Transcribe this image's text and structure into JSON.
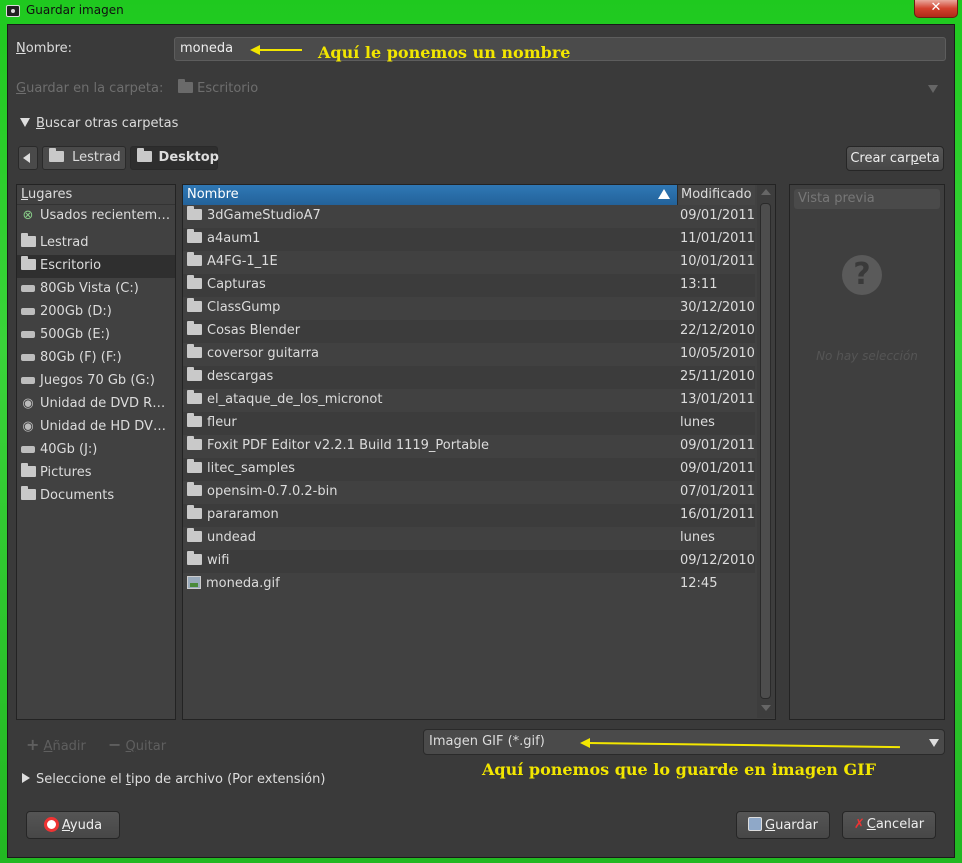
{
  "window": {
    "title": "Guardar imagen",
    "close_glyph": "✕"
  },
  "form": {
    "name_label_mnemonic": "N",
    "name_label_rest": "ombre:",
    "name_value": "moneda",
    "save_in_mnemonic": "G",
    "save_in_rest": "uardar en la carpeta:",
    "save_in_value": "Escritorio",
    "browse_mnemonic": "B",
    "browse_rest": "uscar otras carpetas"
  },
  "annotations": {
    "name_note": "Aquí le ponemos un nombre",
    "type_note": "Aquí ponemos que lo guarde en imagen GIF"
  },
  "path_bar": {
    "segments": [
      "Lestrad",
      "Desktop"
    ],
    "create_folder_prefix": "Crear car",
    "create_folder_mnemonic": "p",
    "create_folder_suffix": "eta"
  },
  "places": {
    "header_mnemonic": "L",
    "header_rest": "ugares",
    "items": [
      {
        "label": "Usados recientem…",
        "icon": "recent-icon"
      },
      {
        "label": "Lestrad",
        "icon": "folder-icon"
      },
      {
        "label": "Escritorio",
        "icon": "folder-icon",
        "selected": true
      },
      {
        "label": "80Gb Vista (C:)",
        "icon": "drive-icon"
      },
      {
        "label": "200Gb (D:)",
        "icon": "drive-icon"
      },
      {
        "label": "500Gb (E:)",
        "icon": "drive-icon"
      },
      {
        "label": "80Gb (F) (F:)",
        "icon": "drive-icon"
      },
      {
        "label": "Juegos 70 Gb (G:)",
        "icon": "drive-icon"
      },
      {
        "label": "Unidad de DVD R…",
        "icon": "dvd-icon"
      },
      {
        "label": "Unidad de HD DV…",
        "icon": "dvd-icon"
      },
      {
        "label": "40Gb (J:)",
        "icon": "drive-icon"
      },
      {
        "label": "Pictures",
        "icon": "folder-icon"
      },
      {
        "label": "Documents",
        "icon": "folder-icon"
      }
    ],
    "add_mnemonic": "A",
    "add_rest": "ñadir",
    "remove_mnemonic": "Q",
    "remove_rest": "uitar"
  },
  "files": {
    "col_name": "Nombre",
    "col_modified": "Modificado",
    "rows": [
      {
        "name": "3dGameStudioA7",
        "date": "09/01/2011",
        "icon": "folder-icon"
      },
      {
        "name": "a4aum1",
        "date": "11/01/2011",
        "icon": "folder-icon"
      },
      {
        "name": "A4FG-1_1E",
        "date": "10/01/2011",
        "icon": "folder-icon"
      },
      {
        "name": "Capturas",
        "date": "13:11",
        "icon": "folder-icon"
      },
      {
        "name": "ClassGump",
        "date": "30/12/2010",
        "icon": "folder-icon"
      },
      {
        "name": "Cosas Blender",
        "date": "22/12/2010",
        "icon": "folder-icon"
      },
      {
        "name": "coversor guitarra",
        "date": "10/05/2010",
        "icon": "folder-icon"
      },
      {
        "name": "descargas",
        "date": "25/11/2010",
        "icon": "folder-icon"
      },
      {
        "name": "el_ataque_de_los_micronot",
        "date": "13/01/2011",
        "icon": "folder-icon"
      },
      {
        "name": "fleur",
        "date": "lunes",
        "icon": "folder-icon"
      },
      {
        "name": "Foxit PDF Editor v2.2.1 Build 1119_Portable",
        "date": "09/01/2011",
        "icon": "folder-icon"
      },
      {
        "name": "litec_samples",
        "date": "09/01/2011",
        "icon": "folder-icon"
      },
      {
        "name": "opensim-0.7.0.2-bin",
        "date": "07/01/2011",
        "icon": "folder-icon"
      },
      {
        "name": "pararamon",
        "date": "16/01/2011",
        "icon": "folder-icon"
      },
      {
        "name": "undead",
        "date": "lunes",
        "icon": "folder-icon"
      },
      {
        "name": "wifi",
        "date": "09/12/2010",
        "icon": "folder-icon"
      },
      {
        "name": "moneda.gif",
        "date": "12:45",
        "icon": "gif-file-icon"
      }
    ]
  },
  "preview": {
    "header": "Vista previa",
    "empty_text": "No hay selección"
  },
  "file_type": {
    "selected": "Imagen GIF (*.gif)",
    "expander_prefix": "Seleccione el ",
    "expander_mnemonic": "t",
    "expander_rest": "ipo de archivo (Por extensión)"
  },
  "buttons": {
    "help_mnemonic": "A",
    "help_rest": "yuda",
    "save_mnemonic": "G",
    "save_rest": "uardar",
    "cancel_mnemonic": "C",
    "cancel_rest": "ancelar"
  },
  "colors": {
    "window_frame": "#2bb52b",
    "dialog_bg": "#3a3a3a",
    "selection_header": "#2f78b5",
    "annotation_yellow": "#f2e600"
  }
}
